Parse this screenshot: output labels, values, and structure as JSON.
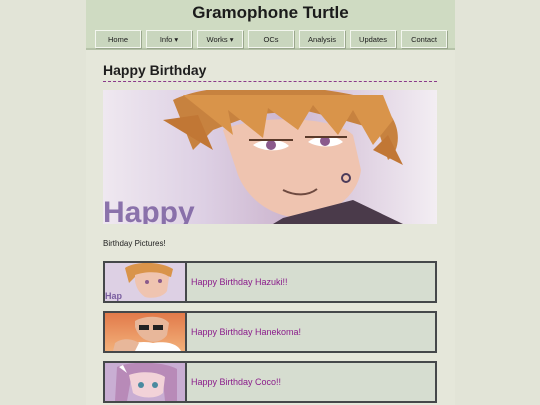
{
  "header": {
    "site_title": "Gramophone Turtle"
  },
  "nav": {
    "items": [
      {
        "label": "Home"
      },
      {
        "label": "Info ▾"
      },
      {
        "label": "Works ▾"
      },
      {
        "label": "OCs"
      },
      {
        "label": "Analysis"
      },
      {
        "label": "Updates"
      },
      {
        "label": "Contact"
      }
    ]
  },
  "main": {
    "title": "Happy Birthday",
    "banner_text": "Happy",
    "section_label": "Birthday Pictures!",
    "birthdays": [
      {
        "label": "Happy Birthday Hazuki!!"
      },
      {
        "label": "Happy Birthday Hanekoma!"
      },
      {
        "label": "Happy Birthday Coco!!"
      }
    ]
  },
  "colors": {
    "background": "#e2e4d7",
    "header": "#cfdbc2",
    "link": "#8b1c8b",
    "dashed_rule": "#8a3a8a"
  }
}
